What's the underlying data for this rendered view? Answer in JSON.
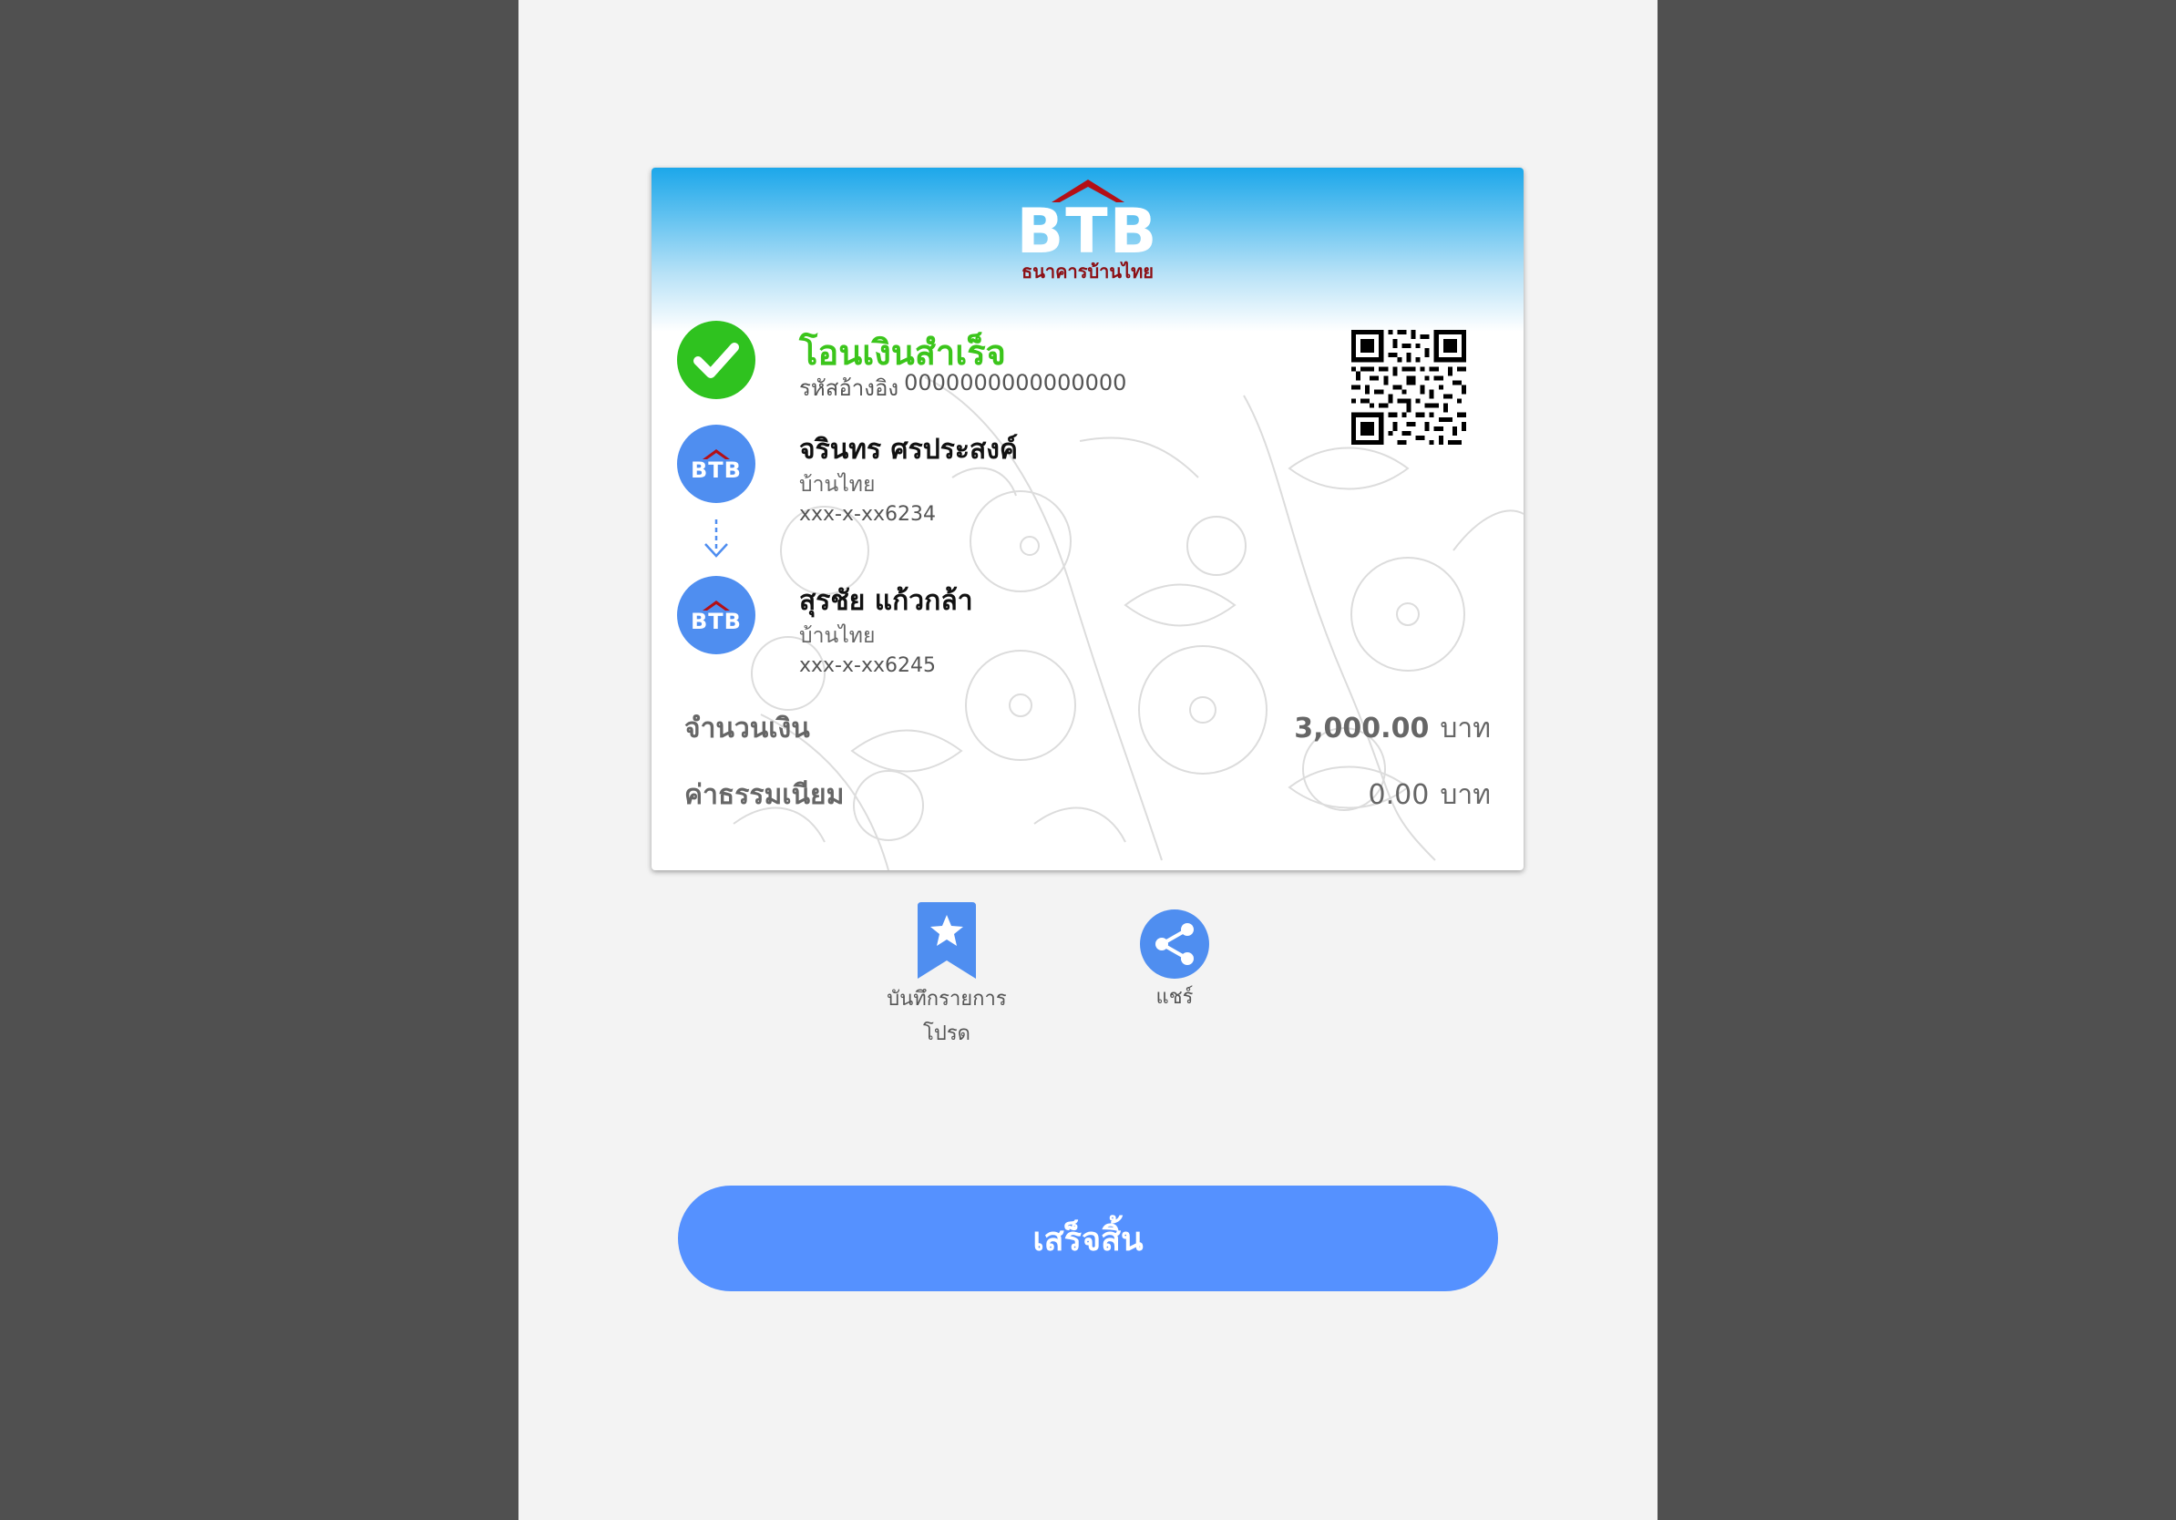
{
  "logo": {
    "text": "BTB",
    "subtitle": "ธนาคารบ้านไทย",
    "roof_color": "#b40f16",
    "subtitle_color": "#8c0f14"
  },
  "status": {
    "title": "โอนเงินสำเร็จ",
    "ref_label": "รหัสอ้างอิง",
    "ref_value": "0000000000000000",
    "icon": "check-circle-icon",
    "color": "#2fc21f"
  },
  "sender": {
    "name": "จรินทร ศรประสงค์",
    "bank": "บ้านไทย",
    "account": "xxx-x-xx6234",
    "icon_text": "BTB"
  },
  "receiver": {
    "name": "สุรชัย แก้วกล้า",
    "bank": "บ้านไทย",
    "account": "xxx-x-xx6245",
    "icon_text": "BTB"
  },
  "amount": {
    "label": "จำนวนเงิน",
    "value": "3,000.00",
    "unit": "บาท"
  },
  "fee": {
    "label": "ค่าธรรมเนียม",
    "value": "0.00",
    "unit": "บาท"
  },
  "actions": {
    "favorite_label_line1": "บันทึกรายการ",
    "favorite_label_line2": "โปรด",
    "share_label": "แชร์"
  },
  "done_button": "เสร็จสิ้น",
  "colors": {
    "accent": "#5591ff",
    "bank_icon": "#4f8ef0",
    "success": "#3bc51b",
    "outer_bg": "#505050",
    "screen_bg": "#f3f3f3"
  }
}
